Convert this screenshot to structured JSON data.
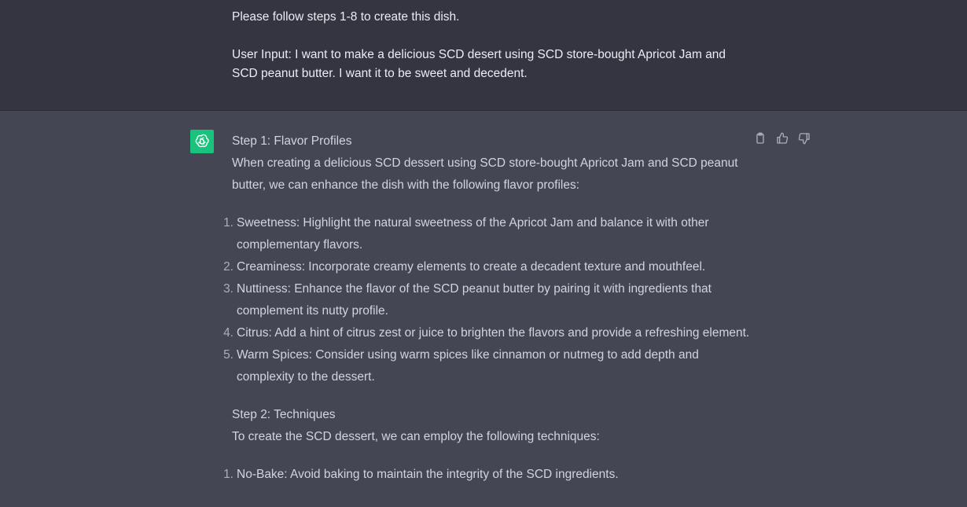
{
  "user_message": {
    "line1": "Please follow steps 1-8 to create this dish.",
    "line2": "User Input: I want to make a delicious SCD desert using SCD store-bought Apricot Jam and SCD peanut butter. I want it to be sweet and decedent."
  },
  "assistant": {
    "avatar_icon": "openai-logo-icon",
    "avatar_color": "#19c37d",
    "step1": {
      "title": "Step 1: Flavor Profiles",
      "intro": "When creating a delicious SCD dessert using SCD store-bought Apricot Jam and SCD peanut butter, we can enhance the dish with the following flavor profiles:",
      "items": [
        {
          "num": "1.",
          "text": "Sweetness: Highlight the natural sweetness of the Apricot Jam and balance it with other complementary flavors."
        },
        {
          "num": "2.",
          "text": "Creaminess: Incorporate creamy elements to create a decadent texture and mouthfeel."
        },
        {
          "num": "3.",
          "text": "Nuttiness: Enhance the flavor of the SCD peanut butter by pairing it with ingredients that complement its nutty profile."
        },
        {
          "num": "4.",
          "text": "Citrus: Add a hint of citrus zest or juice to brighten the flavors and provide a refreshing element."
        },
        {
          "num": "5.",
          "text": "Warm Spices: Consider using warm spices like cinnamon or nutmeg to add depth and complexity to the dessert."
        }
      ]
    },
    "step2": {
      "title": "Step 2: Techniques",
      "intro": "To create the SCD dessert, we can employ the following techniques:",
      "items": [
        {
          "num": "1.",
          "text": "No-Bake: Avoid baking to maintain the integrity of the SCD ingredients."
        }
      ]
    }
  },
  "actions": {
    "copy_icon": "clipboard-icon",
    "like_icon": "thumbs-up-icon",
    "dislike_icon": "thumbs-down-icon"
  }
}
